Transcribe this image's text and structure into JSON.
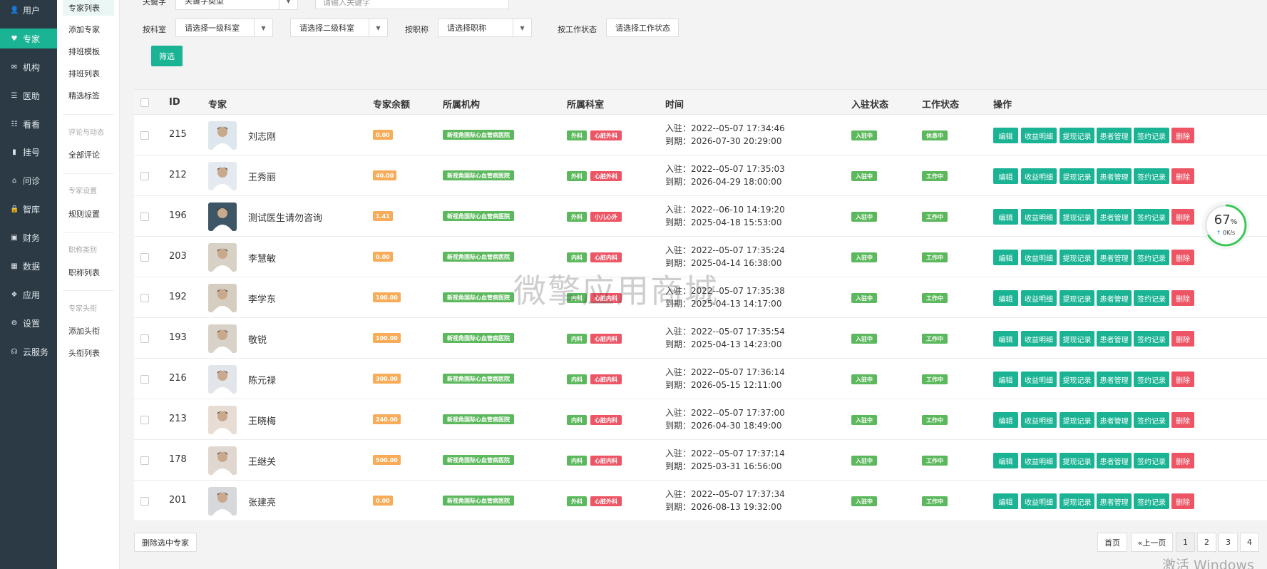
{
  "sidebar": {
    "items": [
      {
        "label": "用户",
        "icon": "user-icon",
        "glyph": "👤"
      },
      {
        "label": "专家",
        "icon": "heart-icon",
        "glyph": "♥"
      },
      {
        "label": "机构",
        "icon": "mail-icon",
        "glyph": "✉"
      },
      {
        "label": "医助",
        "icon": "list-icon",
        "glyph": "☰"
      },
      {
        "label": "看看",
        "icon": "list-alt-icon",
        "glyph": "☷"
      },
      {
        "label": "挂号",
        "icon": "signal-icon",
        "glyph": "▮"
      },
      {
        "label": "问诊",
        "icon": "home-icon",
        "glyph": "⌂"
      },
      {
        "label": "智库",
        "icon": "lock-icon",
        "glyph": "🔒"
      },
      {
        "label": "财务",
        "icon": "wallet-icon",
        "glyph": "▣"
      },
      {
        "label": "数据",
        "icon": "grid-icon",
        "glyph": "▦"
      },
      {
        "label": "应用",
        "icon": "cubes-icon",
        "glyph": "❖"
      },
      {
        "label": "设置",
        "icon": "gear-icon",
        "glyph": "⚙"
      },
      {
        "label": "云服务",
        "icon": "headset-icon",
        "glyph": "☊"
      }
    ],
    "active_index": 1
  },
  "submenu": {
    "items": [
      "专家列表",
      "添加专家",
      "排班模板",
      "排班列表",
      "精选标签"
    ],
    "group_review": "评论与动态",
    "review_items": [
      "全部评论"
    ],
    "group_settings": "专家设置",
    "settings_items": [
      "规则设置"
    ],
    "group_titles": "职称类别",
    "titles_items": [
      "职称列表"
    ],
    "group_headline": "专家头衔",
    "headline_items": [
      "添加头衔",
      "头衔列表"
    ]
  },
  "filter": {
    "keyword_label": "关键字",
    "keyword_type": "关键字类型",
    "keyword_placeholder": "请输入关键字",
    "dept_label": "按科室",
    "dept1": "请选择一级科室",
    "dept2": "请选择二级科室",
    "title_label": "按职称",
    "title_select": "请选择职称",
    "status_label": "按工作状态",
    "status_select": "请选择工作状态",
    "submit": "筛选"
  },
  "table": {
    "headers": [
      "ID",
      "专家",
      "专家余额",
      "所属机构",
      "所属科室",
      "时间",
      "入驻状态",
      "工作状态",
      "操作"
    ],
    "rows": [
      {
        "id": "215",
        "name": "刘志刚",
        "balance": "0.00",
        "org": "新视角国际心血管病医院",
        "dept1": "外科",
        "dept2": "心脏外科",
        "join": "入驻：2022--05-07 17:34:46",
        "expire": "到期：2026-07-30 20:29:00",
        "join_status": "入驻中",
        "work_status": "休息中"
      },
      {
        "id": "212",
        "name": "王秀丽",
        "balance": "40.00",
        "org": "新视角国际心血管病医院",
        "dept1": "外科",
        "dept2": "心脏外科",
        "join": "入驻：2022--05-07 17:35:03",
        "expire": "到期：2026-04-29 18:00:00",
        "join_status": "入驻中",
        "work_status": "工作中"
      },
      {
        "id": "196",
        "name": "测试医生请勿咨询",
        "balance": "1.41",
        "org": "新视角国际心血管病医院",
        "dept1": "外科",
        "dept2": "小儿心外",
        "join": "入驻：2022--06-10 14:19:20",
        "expire": "到期：2025-04-18 15:53:00",
        "join_status": "入驻中",
        "work_status": "工作中"
      },
      {
        "id": "203",
        "name": "李慧敏",
        "balance": "0.00",
        "org": "新视角国际心血管病医院",
        "dept1": "内科",
        "dept2": "心脏内科",
        "join": "入驻：2022--05-07 17:35:24",
        "expire": "到期：2025-04-14 16:38:00",
        "join_status": "入驻中",
        "work_status": "工作中"
      },
      {
        "id": "192",
        "name": "李学东",
        "balance": "100.00",
        "org": "新视角国际心血管病医院",
        "dept1": "内科",
        "dept2": "心脏内科",
        "join": "入驻：2022--05-07 17:35:38",
        "expire": "到期：2025-04-13 14:17:00",
        "join_status": "入驻中",
        "work_status": "工作中"
      },
      {
        "id": "193",
        "name": "敬锐",
        "balance": "100.00",
        "org": "新视角国际心血管病医院",
        "dept1": "内科",
        "dept2": "心脏内科",
        "join": "入驻：2022--05-07 17:35:54",
        "expire": "到期：2025-04-13 14:23:00",
        "join_status": "入驻中",
        "work_status": "工作中"
      },
      {
        "id": "216",
        "name": "陈元禄",
        "balance": "300.00",
        "org": "新视角国际心血管病医院",
        "dept1": "内科",
        "dept2": "心脏内科",
        "join": "入驻：2022--05-07 17:36:14",
        "expire": "到期：2026-05-15 12:11:00",
        "join_status": "入驻中",
        "work_status": "工作中"
      },
      {
        "id": "213",
        "name": "王晓梅",
        "balance": "240.00",
        "org": "新视角国际心血管病医院",
        "dept1": "内科",
        "dept2": "心脏内科",
        "join": "入驻：2022--05-07 17:37:00",
        "expire": "到期：2026-04-30 18:49:00",
        "join_status": "入驻中",
        "work_status": "工作中"
      },
      {
        "id": "178",
        "name": "王继关",
        "balance": "500.00",
        "org": "新视角国际心血管病医院",
        "dept1": "内科",
        "dept2": "心脏内科",
        "join": "入驻：2022--05-07 17:37:14",
        "expire": "到期：2025-03-31 16:56:00",
        "join_status": "入驻中",
        "work_status": "工作中"
      },
      {
        "id": "201",
        "name": "张建亮",
        "balance": "0.00",
        "org": "新视角国际心血管病医院",
        "dept1": "外科",
        "dept2": "心脏外科",
        "join": "入驻：2022--05-07 17:37:34",
        "expire": "到期：2026-08-13 19:32:00",
        "join_status": "入驻中",
        "work_status": "工作中"
      }
    ],
    "actions": [
      "编辑",
      "收益明细",
      "提现记录",
      "患者管理",
      "签约记录",
      "删除"
    ]
  },
  "footer": {
    "delete_selected": "删除选中专家",
    "pages": [
      "首页",
      "«上一页",
      "1",
      "2",
      "3",
      "4"
    ],
    "current_page": "1"
  },
  "overlay": {
    "watermark": "微擎应用商城",
    "windows": "激活 Windows",
    "gauge_percent": "67",
    "gauge_unit": "%",
    "gauge_fraction": 0.67,
    "gauge_speed": "0K/s",
    "gauge_arrow": "↑"
  },
  "colors": {
    "accent": "#1ab394",
    "danger": "#ed5565",
    "warning": "#f8ac59",
    "sidebar_bg": "#2b3a44"
  }
}
